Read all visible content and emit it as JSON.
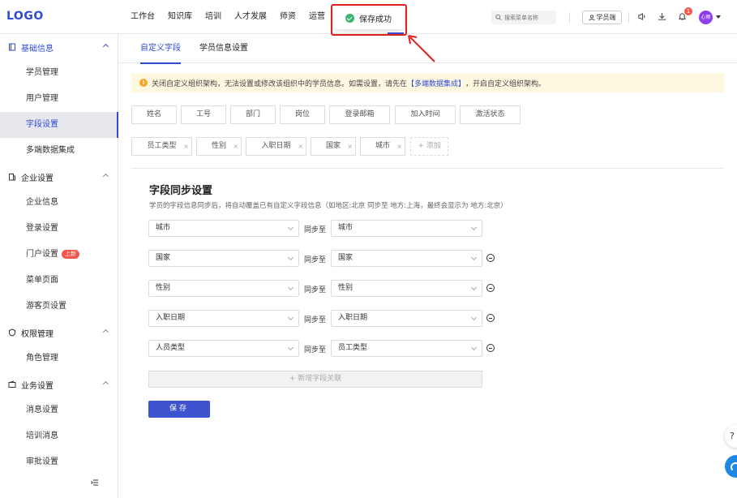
{
  "logo": "LOGO",
  "nav": [
    "工作台",
    "知识库",
    "培训",
    "人才发展",
    "师资",
    "运营"
  ],
  "search": {
    "placeholder": "搜索菜单名称"
  },
  "student_end": "学员端",
  "notification_count": "1",
  "avatar_text": "心雨",
  "toast": "保存成功",
  "sidebar": {
    "groups": [
      {
        "label": "基础信息",
        "icon": "book-icon",
        "items": [
          "学员管理",
          "用户管理",
          "字段设置",
          "多端数据集成"
        ]
      },
      {
        "label": "企业设置",
        "icon": "building-icon",
        "items": [
          "企业信息",
          "登录设置",
          "门户设置",
          "菜单页面",
          "游客页设置"
        ]
      },
      {
        "label": "权限管理",
        "icon": "shield-icon",
        "items": [
          "角色管理"
        ]
      },
      {
        "label": "业务设置",
        "icon": "wallet-icon",
        "items": [
          "消息设置",
          "培训消息",
          "审批设置"
        ]
      }
    ],
    "new_badge": "上新"
  },
  "tabs": [
    "自定义字段",
    "学员信息设置"
  ],
  "notice": {
    "before": "关闭自定义组织架构，无法设置或修改该组织中的学员信息。如需设置，请先在",
    "link": "【多端数据集成】",
    "after": "，开启自定义组织架构。"
  },
  "fixed_fields": [
    "姓名",
    "工号",
    "部门",
    "岗位",
    "登录邮箱",
    "加入时间",
    "激活状态"
  ],
  "custom_fields": [
    "员工类型",
    "性别",
    "入职日期",
    "国家",
    "城市"
  ],
  "add_label": "+ 添加",
  "sync": {
    "title": "字段同步设置",
    "desc": "学员的字段信息同步后，将自动覆盖已有自定义字段信息（如地区:北京 同步至 地方:上海，最终会显示为 地方:北京）",
    "to_label": "同步至",
    "rows": [
      {
        "from": "城市",
        "to": "城市"
      },
      {
        "from": "国家",
        "to": "国家"
      },
      {
        "from": "性别",
        "to": "性别"
      },
      {
        "from": "入职日期",
        "to": "入职日期"
      },
      {
        "from": "人员类型",
        "to": "员工类型"
      }
    ],
    "add_row": "+ 新增字段关联",
    "save": "保存"
  },
  "help": "?"
}
